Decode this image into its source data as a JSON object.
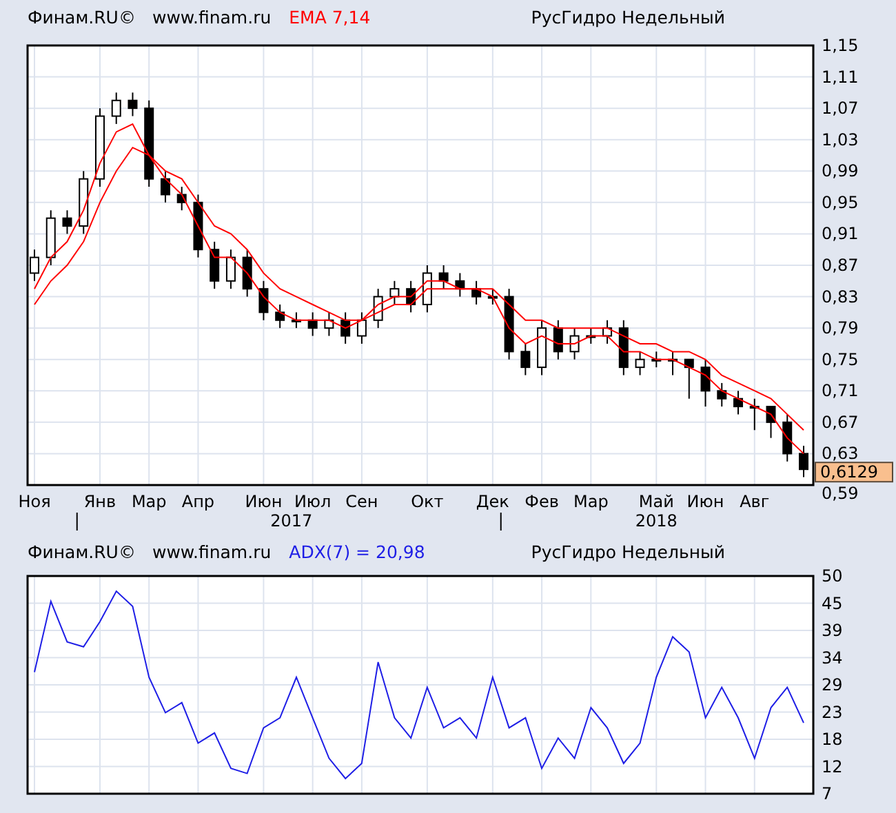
{
  "panels": [
    {
      "header": {
        "source": "Финам.RU©",
        "site": "www.finam.ru",
        "indicator": "EMA 7,14",
        "title": "РусГидро Недельный"
      },
      "price_tag": "0,6129",
      "chart_data": {
        "type": "candlestick",
        "grid": true,
        "ylim": [
          0.59,
          1.15
        ],
        "categories": [
          "Ноя",
          null,
          null,
          null,
          "Янв",
          null,
          null,
          "Мар",
          null,
          null,
          "Апр",
          null,
          null,
          null,
          "Июн",
          null,
          null,
          "Июл",
          null,
          null,
          "Сен",
          null,
          null,
          null,
          "Окт",
          null,
          null,
          null,
          "Дек",
          null,
          null,
          "Фев",
          null,
          null,
          "Мар",
          null,
          null,
          null,
          "Май",
          null,
          null,
          "Июн",
          null,
          null,
          "Авг",
          null,
          null,
          null
        ],
        "yticks": [
          {
            "value": 1.15,
            "label": "1,15"
          },
          {
            "value": 1.11,
            "label": "1,11"
          },
          {
            "value": 1.07,
            "label": "1,07"
          },
          {
            "value": 1.03,
            "label": "1,03"
          },
          {
            "value": 0.99,
            "label": "0,99"
          },
          {
            "value": 0.95,
            "label": "0,95"
          },
          {
            "value": 0.91,
            "label": "0,91"
          },
          {
            "value": 0.87,
            "label": "0,87"
          },
          {
            "value": 0.83,
            "label": "0,83"
          },
          {
            "value": 0.79,
            "label": "0,79"
          },
          {
            "value": 0.75,
            "label": "0,75"
          },
          {
            "value": 0.71,
            "label": "0,71"
          },
          {
            "value": 0.67,
            "label": "0,67"
          },
          {
            "value": 0.63,
            "label": "0,63"
          },
          {
            "value": 0.59,
            "label": "0,59"
          }
        ],
        "annotations": [
          "2017",
          "2018"
        ],
        "ohlc": [
          [
            0.86,
            0.89,
            0.85,
            0.88
          ],
          [
            0.88,
            0.94,
            0.87,
            0.93
          ],
          [
            0.93,
            0.94,
            0.91,
            0.92
          ],
          [
            0.92,
            0.99,
            0.91,
            0.98
          ],
          [
            0.98,
            1.07,
            0.97,
            1.06
          ],
          [
            1.06,
            1.09,
            1.05,
            1.08
          ],
          [
            1.08,
            1.09,
            1.06,
            1.07
          ],
          [
            1.07,
            1.08,
            0.97,
            0.98
          ],
          [
            0.98,
            0.99,
            0.95,
            0.96
          ],
          [
            0.96,
            0.97,
            0.94,
            0.95
          ],
          [
            0.95,
            0.96,
            0.88,
            0.89
          ],
          [
            0.89,
            0.9,
            0.84,
            0.85
          ],
          [
            0.85,
            0.89,
            0.84,
            0.88
          ],
          [
            0.88,
            0.89,
            0.83,
            0.84
          ],
          [
            0.84,
            0.85,
            0.8,
            0.81
          ],
          [
            0.81,
            0.82,
            0.79,
            0.8
          ],
          [
            0.8,
            0.81,
            0.79,
            0.8
          ],
          [
            0.8,
            0.81,
            0.78,
            0.79
          ],
          [
            0.79,
            0.81,
            0.78,
            0.8
          ],
          [
            0.8,
            0.81,
            0.77,
            0.78
          ],
          [
            0.78,
            0.81,
            0.77,
            0.8
          ],
          [
            0.8,
            0.84,
            0.79,
            0.83
          ],
          [
            0.83,
            0.85,
            0.82,
            0.84
          ],
          [
            0.84,
            0.85,
            0.81,
            0.82
          ],
          [
            0.82,
            0.87,
            0.81,
            0.86
          ],
          [
            0.86,
            0.87,
            0.84,
            0.85
          ],
          [
            0.85,
            0.86,
            0.83,
            0.84
          ],
          [
            0.84,
            0.85,
            0.82,
            0.83
          ],
          [
            0.83,
            0.84,
            0.82,
            0.83
          ],
          [
            0.83,
            0.84,
            0.75,
            0.76
          ],
          [
            0.76,
            0.77,
            0.73,
            0.74
          ],
          [
            0.74,
            0.8,
            0.73,
            0.79
          ],
          [
            0.79,
            0.8,
            0.75,
            0.76
          ],
          [
            0.76,
            0.79,
            0.75,
            0.78
          ],
          [
            0.78,
            0.79,
            0.77,
            0.78
          ],
          [
            0.78,
            0.8,
            0.77,
            0.79
          ],
          [
            0.79,
            0.8,
            0.73,
            0.74
          ],
          [
            0.74,
            0.76,
            0.73,
            0.75
          ],
          [
            0.75,
            0.76,
            0.74,
            0.75
          ],
          [
            0.75,
            0.76,
            0.73,
            0.75
          ],
          [
            0.75,
            0.75,
            0.7,
            0.74
          ],
          [
            0.74,
            0.75,
            0.69,
            0.71
          ],
          [
            0.71,
            0.72,
            0.69,
            0.7
          ],
          [
            0.7,
            0.71,
            0.68,
            0.69
          ],
          [
            0.69,
            0.7,
            0.66,
            0.69
          ],
          [
            0.69,
            0.69,
            0.65,
            0.67
          ],
          [
            0.67,
            0.68,
            0.62,
            0.63
          ],
          [
            0.63,
            0.64,
            0.6,
            0.61
          ]
        ]
      },
      "ema_overlay": {
        "chart_data": {
          "type": "line",
          "ylim": [
            0.59,
            1.15
          ],
          "series": [
            {
              "color": "#ff0000",
              "values": [
                0.84,
                0.88,
                0.9,
                0.94,
                1.0,
                1.04,
                1.05,
                1.01,
                0.98,
                0.96,
                0.92,
                0.88,
                0.88,
                0.86,
                0.83,
                0.81,
                0.8,
                0.8,
                0.8,
                0.79,
                0.8,
                0.82,
                0.83,
                0.83,
                0.85,
                0.85,
                0.84,
                0.84,
                0.83,
                0.79,
                0.77,
                0.78,
                0.77,
                0.77,
                0.78,
                0.78,
                0.76,
                0.76,
                0.75,
                0.75,
                0.74,
                0.73,
                0.71,
                0.7,
                0.69,
                0.68,
                0.65,
                0.63
              ]
            },
            {
              "color": "#ff0000",
              "values": [
                0.82,
                0.85,
                0.87,
                0.9,
                0.95,
                0.99,
                1.02,
                1.01,
                0.99,
                0.98,
                0.95,
                0.92,
                0.91,
                0.89,
                0.86,
                0.84,
                0.83,
                0.82,
                0.81,
                0.8,
                0.8,
                0.81,
                0.82,
                0.82,
                0.84,
                0.84,
                0.84,
                0.84,
                0.84,
                0.82,
                0.8,
                0.8,
                0.79,
                0.79,
                0.79,
                0.79,
                0.78,
                0.77,
                0.77,
                0.76,
                0.76,
                0.75,
                0.73,
                0.72,
                0.71,
                0.7,
                0.68,
                0.66
              ]
            }
          ]
        }
      }
    },
    {
      "header": {
        "source": "Финам.RU©",
        "site": "www.finam.ru",
        "indicator": "ADX(7) = 20,98",
        "title": "РусГидро Недельный"
      },
      "chart_data": {
        "type": "line",
        "grid": true,
        "ylim": [
          7,
          50
        ],
        "yticks": [
          {
            "value": 50,
            "label": "50"
          },
          {
            "value": 44.625,
            "label": "45"
          },
          {
            "value": 39.25,
            "label": "39"
          },
          {
            "value": 33.875,
            "label": "34"
          },
          {
            "value": 28.5,
            "label": "29"
          },
          {
            "value": 23.125,
            "label": "23"
          },
          {
            "value": 17.75,
            "label": "18"
          },
          {
            "value": 12.375,
            "label": "12"
          },
          {
            "value": 7,
            "label": "7"
          }
        ],
        "series": [
          {
            "color": "#1e1ee6",
            "values": [
              31,
              45,
              37,
              36,
              41,
              47,
              44,
              30,
              23,
              25,
              17,
              19,
              12,
              11,
              20,
              22,
              30,
              22,
              14,
              10,
              13,
              33,
              22,
              18,
              28,
              20,
              22,
              18,
              30,
              20,
              22,
              12,
              18,
              14,
              24,
              20,
              13,
              17,
              30,
              38,
              35,
              22,
              28,
              22,
              14,
              24,
              28,
              21
            ]
          }
        ]
      }
    }
  ]
}
